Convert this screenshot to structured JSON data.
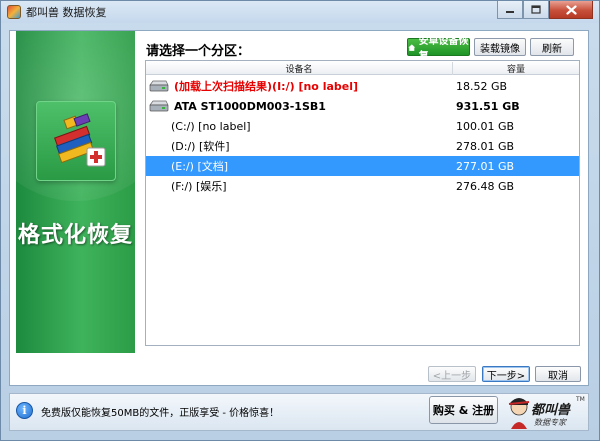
{
  "window": {
    "title": "都叫兽 数据恢复"
  },
  "sidebar": {
    "title": "格式化恢复",
    "art_icon": "books-with-medical-cross-icon"
  },
  "main": {
    "prompt": "请选择一个分区：",
    "toolbar": {
      "install_device_recovery": "安卓设备恢复",
      "mount_image": "装载镜像",
      "refresh": "刷新"
    },
    "table": {
      "columns": [
        "设备名",
        "容量"
      ],
      "rows": [
        {
          "name": "(加载上次扫描结果)(I:/) [no label]",
          "size": "18.52 GB",
          "style": "red",
          "indent": 0,
          "icon": "hard-drive-icon",
          "selected": false
        },
        {
          "name": "ATA ST1000DM003-1SB1",
          "size": "931.51 GB",
          "style": "bold",
          "indent": 0,
          "icon": "hard-drive-icon",
          "selected": false
        },
        {
          "name": "(C:/) [no label]",
          "size": "100.01 GB",
          "style": "normal",
          "indent": 1,
          "icon": "",
          "selected": false
        },
        {
          "name": "(D:/) [软件]",
          "size": "278.01 GB",
          "style": "normal",
          "indent": 1,
          "icon": "",
          "selected": false
        },
        {
          "name": "(E:/) [文档]",
          "size": "277.01 GB",
          "style": "normal",
          "indent": 1,
          "icon": "",
          "selected": true
        },
        {
          "name": "(F:/) [娱乐]",
          "size": "276.48 GB",
          "style": "normal",
          "indent": 1,
          "icon": "",
          "selected": false
        }
      ]
    }
  },
  "nav": {
    "prev": "<上一步",
    "next": "下一步>",
    "cancel": "取消"
  },
  "status": {
    "text": "免费版仅能恢复50MB的文件，正版享受 - 价格惊喜！",
    "buy": "购买 & 注册",
    "brand": "都叫兽",
    "brand_tagline": "数据专家",
    "tm": "TM"
  },
  "colors": {
    "selection": "#3399ff",
    "sidebar_green": "#2c9c47",
    "highlight_red": "#e60000",
    "toolbar_green": "#1f9427"
  }
}
